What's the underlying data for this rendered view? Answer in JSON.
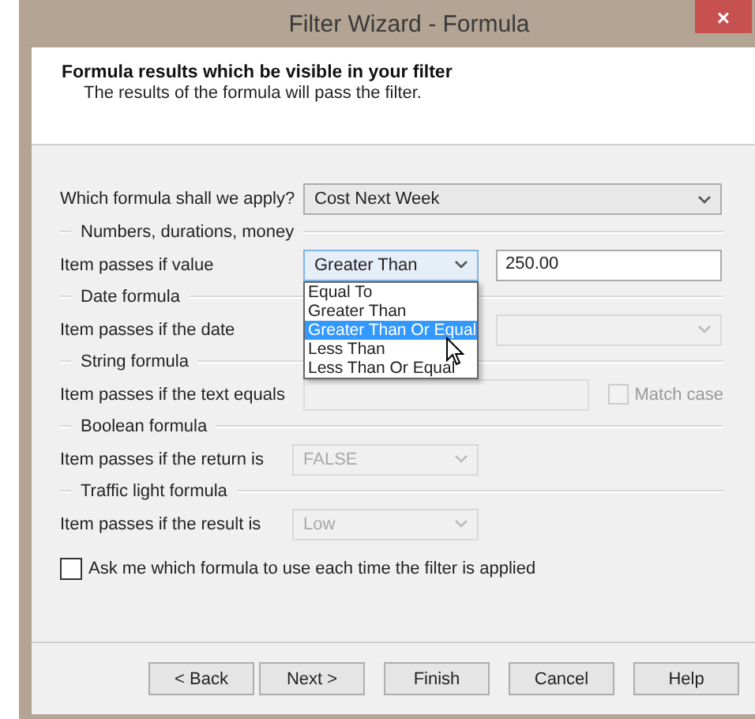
{
  "window": {
    "title": "Filter Wizard - Formula",
    "close": "×"
  },
  "header": {
    "title": "Formula results which be visible in your filter",
    "subtitle": "The results of the formula will pass the filter."
  },
  "formula": {
    "label": "Which formula shall we apply?",
    "value": "Cost Next Week"
  },
  "sections": [
    {
      "kind": "combo-field",
      "heading": "Numbers, durations, money",
      "label": "Item passes if value",
      "combo": {
        "value": "Greater Than",
        "disabled": false,
        "open": true
      },
      "field": {
        "value": "250.00",
        "disabled": false
      },
      "options": [
        {
          "label": "Equal To",
          "selected": false
        },
        {
          "label": "Greater Than",
          "selected": false
        },
        {
          "label": "Greater Than Or Equal",
          "selected": true
        },
        {
          "label": "Less Than",
          "selected": false
        },
        {
          "label": "Less Than Or Equal",
          "selected": false
        }
      ]
    },
    {
      "kind": "wide-combo",
      "heading": "Date formula",
      "label": "Item passes if the date",
      "combo": {
        "disabled": true
      }
    },
    {
      "kind": "text-check",
      "heading": "String formula",
      "label": "Item passes if the text equals",
      "field": {
        "disabled": true
      },
      "checkbox": {
        "label": "Match case",
        "checked": false,
        "disabled": true
      }
    },
    {
      "kind": "combo",
      "heading": "Boolean formula",
      "label": "Item passes if the return is",
      "combo": {
        "value": "FALSE",
        "disabled": true
      }
    },
    {
      "kind": "combo",
      "heading": "Traffic light formula",
      "label": "Item passes if the result is",
      "combo": {
        "value": "Low",
        "disabled": true
      }
    }
  ],
  "ask": {
    "label": "Ask me which formula to use each time the filter is applied",
    "checked": false
  },
  "buttons": [
    "< Back",
    "Next >",
    "Finish",
    "Cancel",
    "Help"
  ]
}
